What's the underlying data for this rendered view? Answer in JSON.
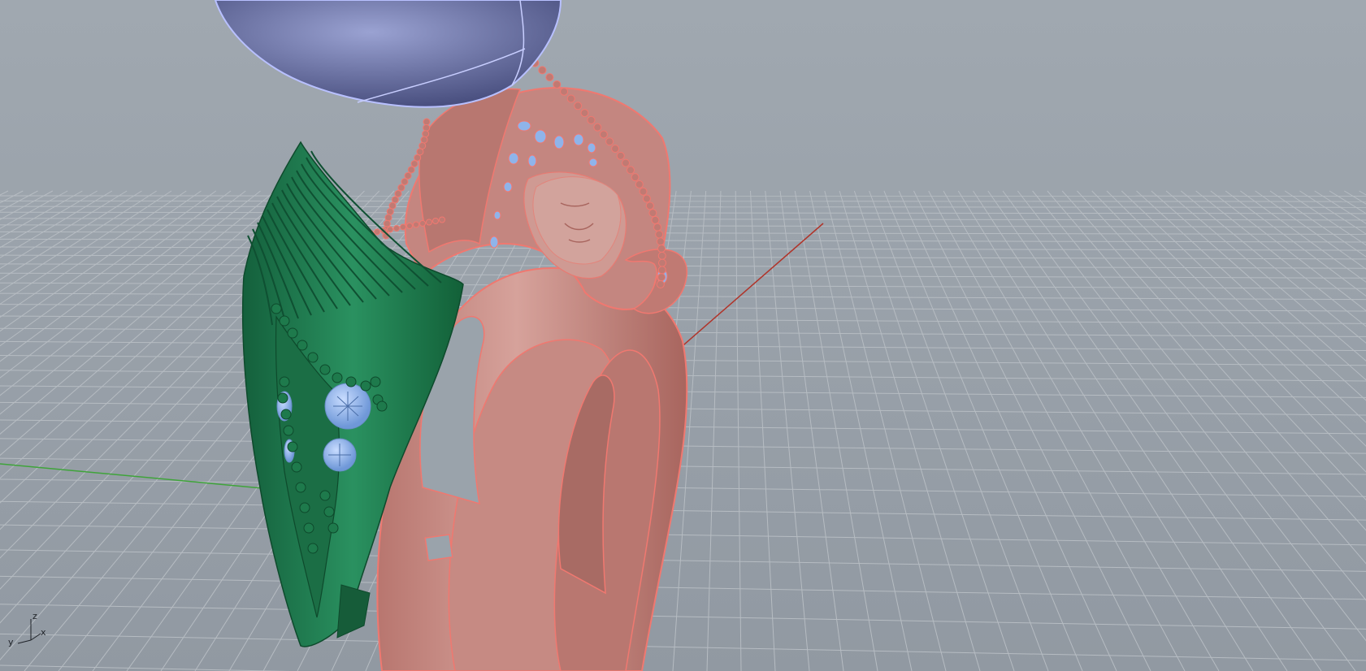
{
  "viewport": {
    "view_type": "perspective",
    "display_mode": "rendered",
    "grid": true,
    "background_color": "#9aa3ab",
    "grid_color": "#b6bcc2",
    "x_axis_color": "#b0342a",
    "y_axis_color": "#3fa43a"
  },
  "objects": [
    {
      "name": "ring-shank",
      "color": "#c98a82",
      "edge_color": "#f07870"
    },
    {
      "name": "green-side-element",
      "color": "#1f7a4e"
    },
    {
      "name": "blue-gemstones",
      "color": "#8fb4ea"
    },
    {
      "name": "purple-center-stone",
      "color": "#6f78a8",
      "edge_color": "#b8c0ff"
    }
  ],
  "axis_widget": {
    "z_label": "z",
    "y_label": "y",
    "x_label": "x"
  }
}
